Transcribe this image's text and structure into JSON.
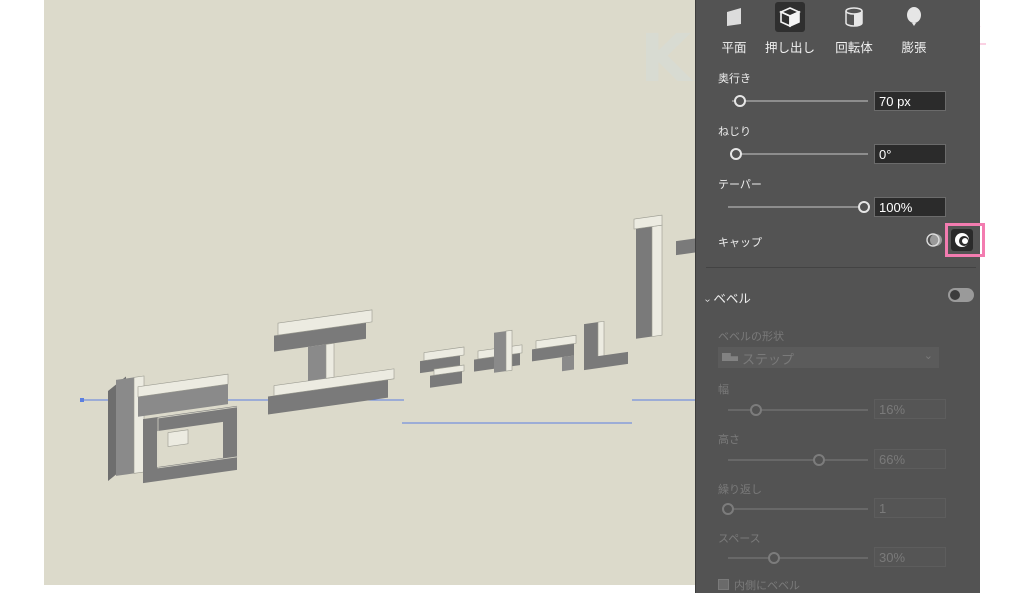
{
  "watermark": "KAKETA",
  "tabs": [
    {
      "label": "平面",
      "icon": "plane-icon",
      "active": false
    },
    {
      "label": "押し出し",
      "icon": "extrude-cube-icon",
      "active": true
    },
    {
      "label": "回転体",
      "icon": "revolve-cylinder-icon",
      "active": false
    },
    {
      "label": "膨張",
      "icon": "inflate-balloon-icon",
      "active": false
    }
  ],
  "depth": {
    "label": "奥行き",
    "value": "70 px",
    "slider": 0.06
  },
  "twist": {
    "label": "ねじり",
    "value": "0°",
    "slider": 0.03
  },
  "taper": {
    "label": "テーパー",
    "value": "100%",
    "slider": 1.0
  },
  "cap": {
    "label": "キャップ",
    "icons": [
      "cap-off-icon",
      "cap-on-icon"
    ]
  },
  "bevel": {
    "title": "ベベル",
    "enabled": false,
    "shape_label": "ベベルの形状",
    "shape_value": "ステップ",
    "width": {
      "label": "幅",
      "value": "16%",
      "slider": 0.2
    },
    "height": {
      "label": "高さ",
      "value": "66%",
      "slider": 0.65
    },
    "repeat": {
      "label": "繰り返し",
      "value": "1",
      "slider": 0.0
    },
    "space": {
      "label": "スペース",
      "value": "30%",
      "slider": 0.33
    },
    "inner_label": "内側にベベル"
  },
  "colors": {
    "canvas": "#dcdacb",
    "panel": "#535353",
    "highlight": "#f37cb0",
    "guide": "#5b7fe0",
    "extrusion": "#7a7a7a"
  }
}
